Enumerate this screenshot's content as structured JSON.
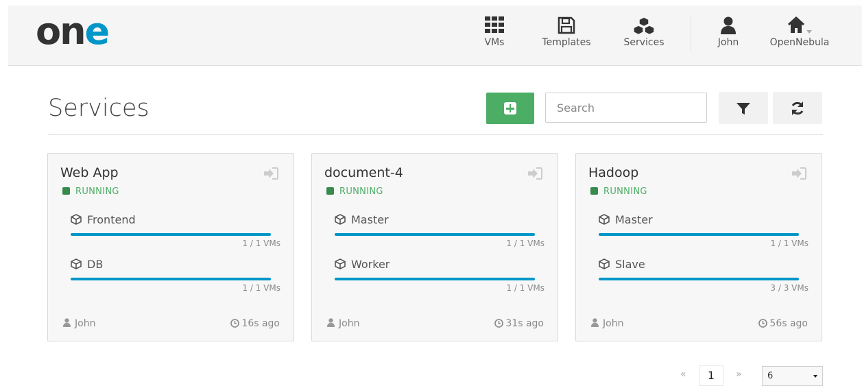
{
  "header": {
    "logo_text": "one",
    "nav": [
      {
        "label": "VMs",
        "icon": "grid-icon"
      },
      {
        "label": "Templates",
        "icon": "save-icon"
      },
      {
        "label": "Services",
        "icon": "cubes-icon"
      },
      {
        "label": "John",
        "icon": "user-icon"
      },
      {
        "label": "OpenNebula",
        "icon": "home-icon"
      }
    ]
  },
  "page": {
    "title": "Services",
    "search_placeholder": "Search"
  },
  "services": [
    {
      "name": "Web App",
      "state": "RUNNING",
      "roles": [
        {
          "name": "Frontend",
          "vms": "1 / 1 VMs",
          "progress": 1.0
        },
        {
          "name": "DB",
          "vms": "1 / 1 VMs",
          "progress": 1.0
        }
      ],
      "owner": "John",
      "age": "16s ago"
    },
    {
      "name": "document-4",
      "state": "RUNNING",
      "roles": [
        {
          "name": "Master",
          "vms": "1 / 1 VMs",
          "progress": 1.0
        },
        {
          "name": "Worker",
          "vms": "1 / 1 VMs",
          "progress": 1.0
        }
      ],
      "owner": "John",
      "age": "31s ago"
    },
    {
      "name": "Hadoop",
      "state": "RUNNING",
      "roles": [
        {
          "name": "Master",
          "vms": "1 / 1 VMs",
          "progress": 1.0
        },
        {
          "name": "Slave",
          "vms": "3 / 3 VMs",
          "progress": 1.0
        }
      ],
      "owner": "John",
      "age": "56s ago"
    }
  ],
  "pagination": {
    "prev": "«",
    "current": "1",
    "next": "»",
    "page_size": "6"
  },
  "colors": {
    "brand_dark": "#333333",
    "brand_blue": "#0096c8",
    "running": "#4cad64",
    "add_button": "#4cad64"
  }
}
